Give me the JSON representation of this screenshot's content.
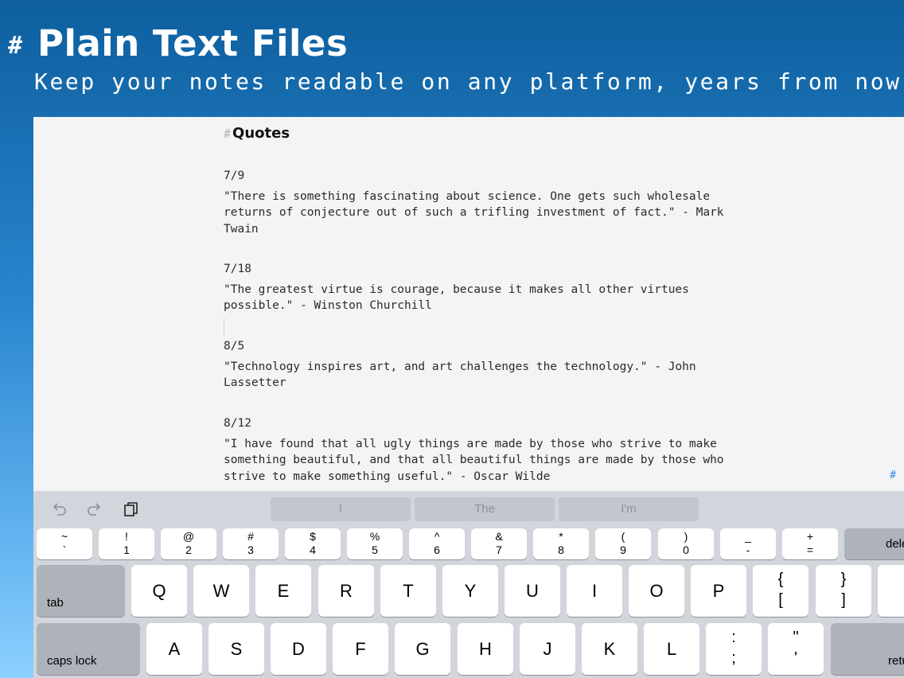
{
  "hero": {
    "hash": "#",
    "title": "Plain Text Files",
    "subtitle": "Keep your notes readable on any platform, years from now."
  },
  "document": {
    "heading_mark": "#",
    "heading": "Quotes",
    "entries": [
      {
        "date": "7/9",
        "quote": "\"There is something fascinating about science. One gets such wholesale\nreturns of conjecture out of such a trifling investment of fact.\" - Mark\nTwain"
      },
      {
        "date": "7/18",
        "quote": "\"The greatest virtue is courage, because it makes all other virtues\npossible.\" - Winston Churchill"
      },
      {
        "date": "8/5",
        "quote": "\"Technology inspires art, and art challenges the technology.\" - John\nLassetter"
      },
      {
        "date": "8/12",
        "quote": "\"I have found that all ugly things are made by those who strive to make\nsomething beautiful, and that all beautiful things are made by those who\nstrive to make something useful.\" - Oscar Wilde"
      }
    ],
    "side_hash": "#"
  },
  "keyboard": {
    "shortcut_icons": [
      "undo-icon",
      "redo-icon",
      "paste-icon"
    ],
    "suggestions": [
      "I",
      "The",
      "I'm"
    ],
    "number_row": [
      {
        "top": "~",
        "bottom": "`"
      },
      {
        "top": "!",
        "bottom": "1"
      },
      {
        "top": "@",
        "bottom": "2"
      },
      {
        "top": "#",
        "bottom": "3"
      },
      {
        "top": "$",
        "bottom": "4"
      },
      {
        "top": "%",
        "bottom": "5"
      },
      {
        "top": "^",
        "bottom": "6"
      },
      {
        "top": "&",
        "bottom": "7"
      },
      {
        "top": "*",
        "bottom": "8"
      },
      {
        "top": "(",
        "bottom": "9"
      },
      {
        "top": ")",
        "bottom": "0"
      },
      {
        "top": "_",
        "bottom": "-"
      },
      {
        "top": "+",
        "bottom": "="
      }
    ],
    "delete_label": "delete",
    "tab_label": "tab",
    "row_qwerty": [
      "Q",
      "W",
      "E",
      "R",
      "T",
      "Y",
      "U",
      "I",
      "O",
      "P"
    ],
    "brace_open": {
      "top": "{",
      "bottom": "["
    },
    "brace_close": {
      "top": "}",
      "bottom": "]"
    },
    "caps_label": "caps lock",
    "row_asdf": [
      "A",
      "S",
      "D",
      "F",
      "G",
      "H",
      "J",
      "K",
      "L"
    ],
    "semicolon": {
      "top": ":",
      "bottom": ";"
    },
    "quote_key": {
      "top": "\"",
      "bottom": "'"
    },
    "return_label": "return"
  }
}
